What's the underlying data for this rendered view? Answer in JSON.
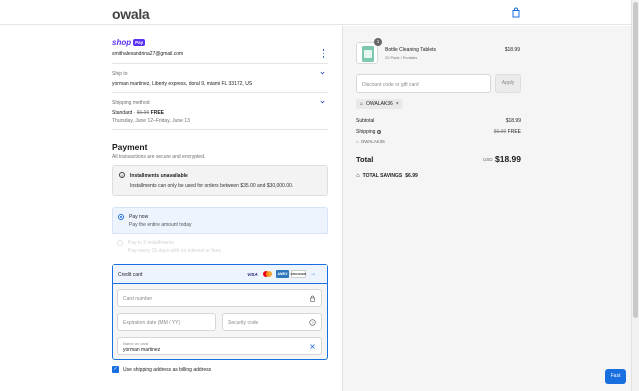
{
  "header": {
    "logo": "owala"
  },
  "contact": {
    "shop_word": "shop",
    "pay_pill": "Pay",
    "email": "smithalexandrina27@gmail.com"
  },
  "ship_to": {
    "label": "Ship to",
    "address": "yorman martinez, Liberty express, doral 9, miami FL 33172, US"
  },
  "shipping_method": {
    "label": "Shipping method",
    "name": "Standard",
    "separator": "·",
    "old_price": "$6.99",
    "price": "FREE",
    "dates": "Thursday, June 12–Friday, June 13"
  },
  "payment": {
    "title": "Payment",
    "subtitle": "All transactions are secure and encrypted.",
    "notice": {
      "title": "Installments unavailable",
      "text": "Installments can only be used for orders between $35.00 and $30,000.00."
    },
    "options": [
      {
        "title": "Pay now",
        "sub": "Pay the entire amount today"
      },
      {
        "title": "Pay in 2 installments",
        "sub": "Pay every 15 days with no interest or fees"
      }
    ],
    "credit_card": {
      "title": "Credit card",
      "brands": [
        "VISA",
        "Mastercard",
        "AMEX",
        "DISCOVER",
        "→"
      ],
      "card_number_placeholder": "Card number",
      "expiry_placeholder": "Expiration date (MM / YY)",
      "security_placeholder": "Security code",
      "name_label": "Name on card",
      "name_value": "yorman martinez"
    },
    "billing_checkbox": "Use shipping address as billing address"
  },
  "cart": {
    "product": {
      "name": "Bottle Cleaning Tablets",
      "variant": "20 Pack / Ecotabs",
      "price": "$18.99",
      "qty": "1"
    },
    "discount_placeholder": "Discount code or gift card",
    "apply_label": "Apply",
    "applied_code": "OWALAK36",
    "subtotal_label": "Subtotal",
    "subtotal_value": "$18.99",
    "shipping_label": "Shipping",
    "shipping_old": "$6.99",
    "shipping_value": "FREE",
    "shipping_code": "OWALAK36",
    "total_label": "Total",
    "currency": "USD",
    "total_value": "$18.99",
    "savings_label": "TOTAL SAVINGS",
    "savings_value": "$6.99"
  },
  "fast_button": "Fast",
  "colors": {
    "accent": "#1a6fe0",
    "shop_purple": "#5a31f4"
  }
}
